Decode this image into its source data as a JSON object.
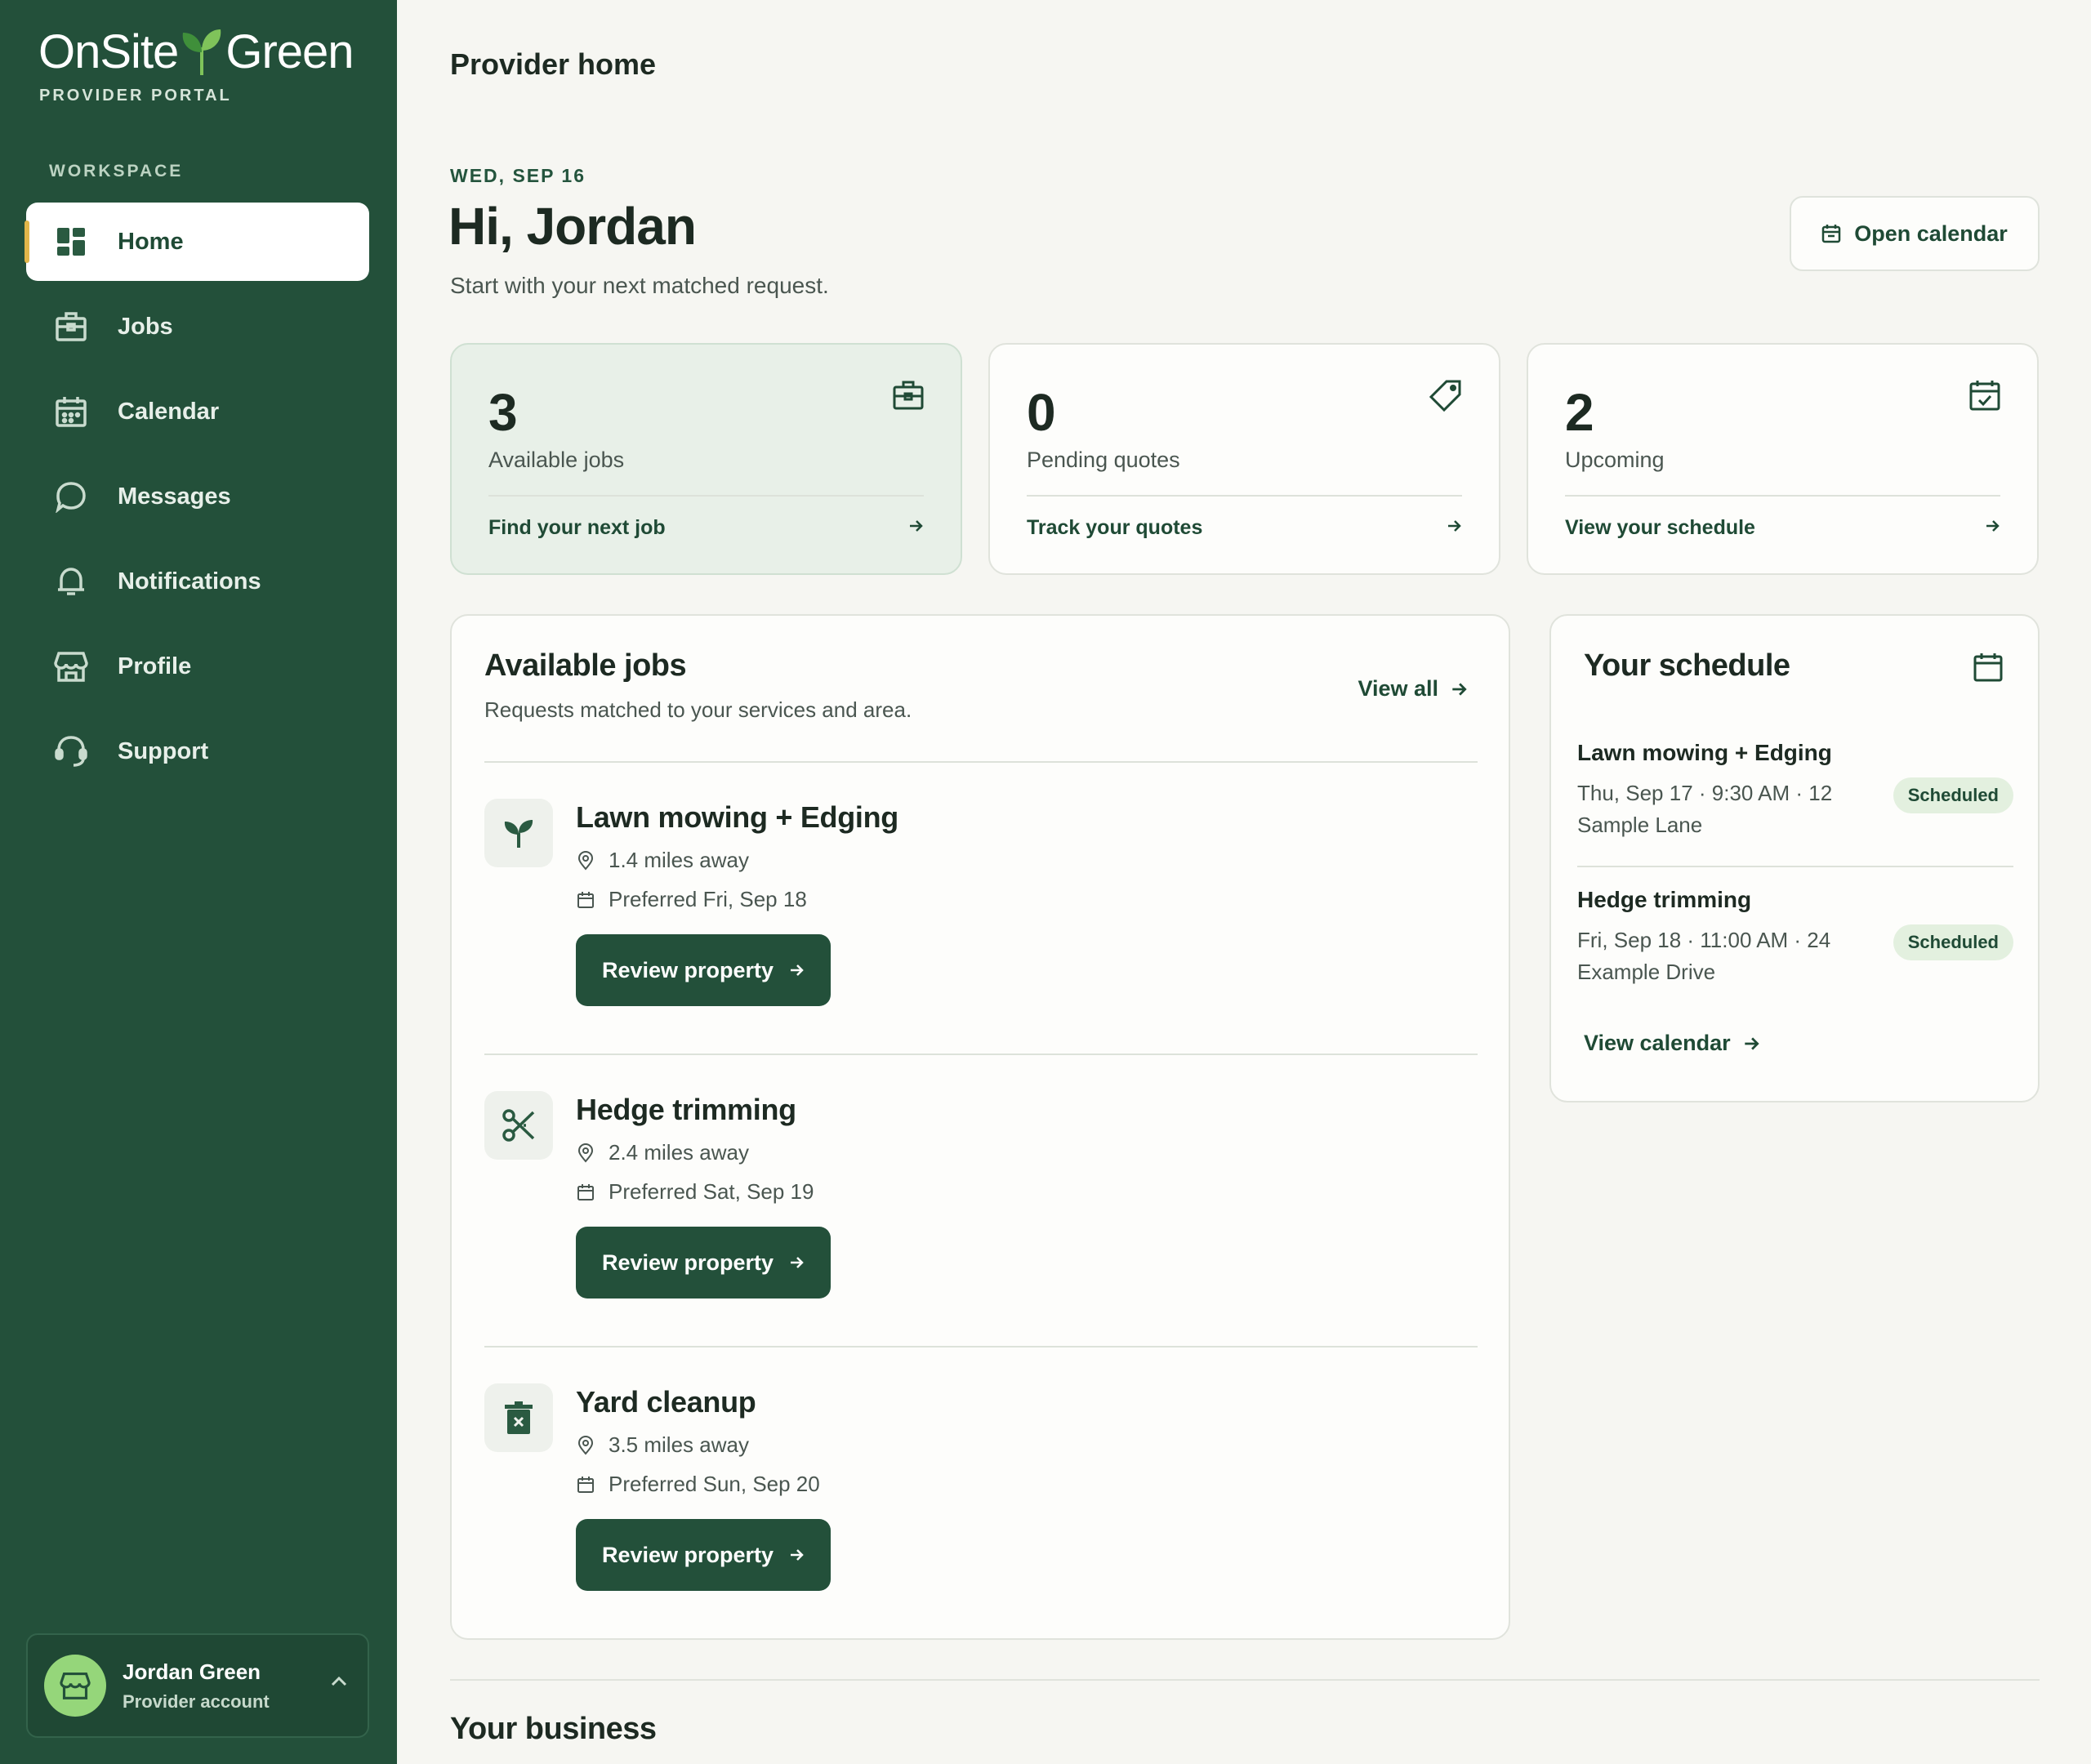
{
  "brand": {
    "name_left": "OnSite",
    "name_right": "Green",
    "portal": "PROVIDER PORTAL"
  },
  "sidebar": {
    "section": "WORKSPACE",
    "items": [
      {
        "label": "Home",
        "icon": "dashboard-icon",
        "active": true
      },
      {
        "label": "Jobs",
        "icon": "briefcase-icon"
      },
      {
        "label": "Calendar",
        "icon": "calendar-icon"
      },
      {
        "label": "Messages",
        "icon": "chat-bubble-icon"
      },
      {
        "label": "Notifications",
        "icon": "bell-icon"
      },
      {
        "label": "Profile",
        "icon": "storefront-icon"
      },
      {
        "label": "Support",
        "icon": "headset-icon"
      }
    ],
    "account": {
      "name": "Jordan Green",
      "role": "Provider account"
    }
  },
  "header": {
    "title": "Provider home"
  },
  "welcome": {
    "date": "WED, SEP 16",
    "greeting": "Hi, Jordan",
    "subtitle": "Start with your next matched request.",
    "open_calendar": "Open calendar"
  },
  "stats": [
    {
      "value": "3",
      "label": "Available jobs",
      "link": "Find your next job",
      "icon": "briefcase-icon"
    },
    {
      "value": "0",
      "label": "Pending quotes",
      "link": "Track your quotes",
      "icon": "tag-icon"
    },
    {
      "value": "2",
      "label": "Upcoming",
      "link": "View your schedule",
      "icon": "calendar-check-icon"
    }
  ],
  "jobs": {
    "title": "Available jobs",
    "subtitle": "Requests matched to your services and area.",
    "view_all": "View all",
    "items": [
      {
        "title": "Lawn mowing + Edging",
        "distance": "1.4 miles away",
        "preferred": "Preferred Fri, Sep 18",
        "button": "Review property",
        "icon": "sprout-icon"
      },
      {
        "title": "Hedge trimming",
        "distance": "2.4 miles away",
        "preferred": "Preferred Sat, Sep 19",
        "button": "Review property",
        "icon": "scissors-icon"
      },
      {
        "title": "Yard cleanup",
        "distance": "3.5 miles away",
        "preferred": "Preferred Sun, Sep 20",
        "button": "Review property",
        "icon": "trash-bin-icon"
      }
    ]
  },
  "schedule": {
    "title": "Your schedule",
    "items": [
      {
        "title": "Lawn mowing + Edging",
        "detail": "Thu, Sep 17 · 9:30 AM · 12 Sample Lane",
        "status": "Scheduled"
      },
      {
        "title": "Hedge trimming",
        "detail": "Fri, Sep 18 · 11:00 AM · 24 Example Drive",
        "status": "Scheduled"
      }
    ],
    "view_calendar": "View calendar"
  },
  "business": {
    "title": "Your business"
  },
  "colors": {
    "sidebar": "#23503a",
    "accent": "#e2b64a",
    "avatar": "#95d67a",
    "badge": "#e3f0df"
  }
}
